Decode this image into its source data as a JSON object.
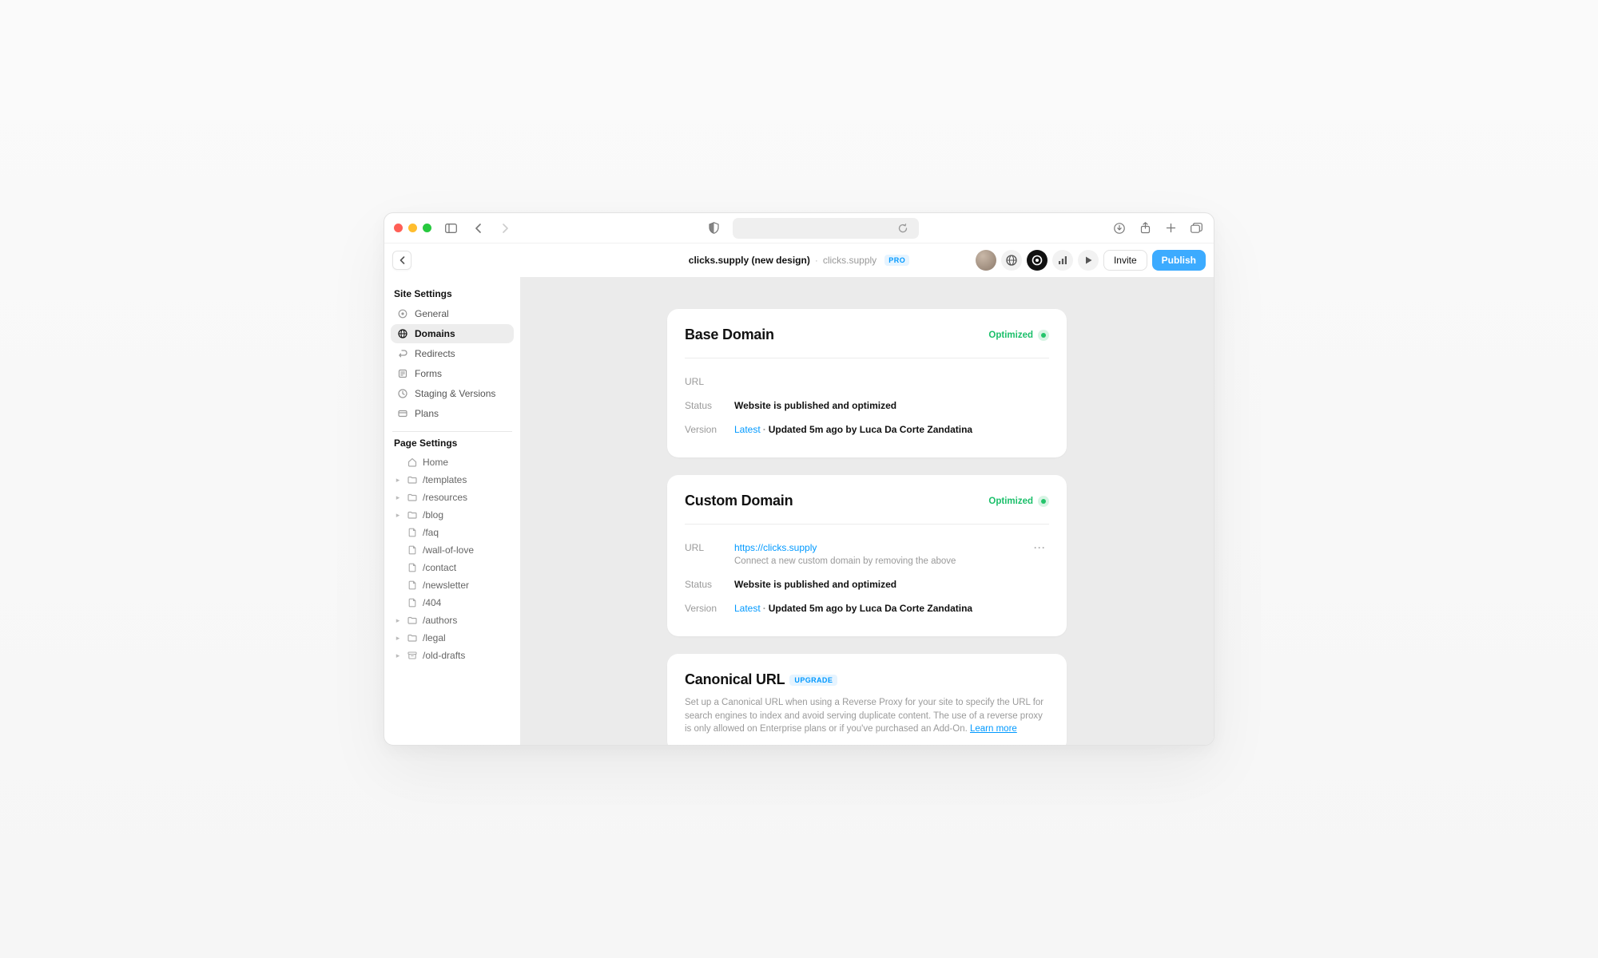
{
  "appbar": {
    "title": "clicks.supply (new design)",
    "subtitle": "clicks.supply",
    "pro_label": "PRO",
    "invite_label": "Invite",
    "publish_label": "Publish"
  },
  "sidebar": {
    "site_settings_header": "Site Settings",
    "site_items": [
      {
        "icon": "gear",
        "label": "General"
      },
      {
        "icon": "globe",
        "label": "Domains"
      },
      {
        "icon": "redirect",
        "label": "Redirects"
      },
      {
        "icon": "form",
        "label": "Forms"
      },
      {
        "icon": "clock",
        "label": "Staging & Versions"
      },
      {
        "icon": "card",
        "label": "Plans"
      }
    ],
    "active_site_index": 1,
    "page_settings_header": "Page Settings",
    "pages": [
      {
        "icon": "home",
        "label": "Home",
        "caret": false
      },
      {
        "icon": "folder",
        "label": "/templates",
        "caret": true
      },
      {
        "icon": "folder",
        "label": "/resources",
        "caret": true
      },
      {
        "icon": "folder",
        "label": "/blog",
        "caret": true
      },
      {
        "icon": "page",
        "label": "/faq",
        "caret": false,
        "indent": true
      },
      {
        "icon": "page",
        "label": "/wall-of-love",
        "caret": false,
        "indent": true
      },
      {
        "icon": "page",
        "label": "/contact",
        "caret": false,
        "indent": true
      },
      {
        "icon": "page",
        "label": "/newsletter",
        "caret": false,
        "indent": true
      },
      {
        "icon": "page",
        "label": "/404",
        "caret": false,
        "indent": true
      },
      {
        "icon": "folder",
        "label": "/authors",
        "caret": true
      },
      {
        "icon": "folder",
        "label": "/legal",
        "caret": true
      },
      {
        "icon": "archive",
        "label": "/old-drafts",
        "caret": true
      }
    ]
  },
  "cards": {
    "base": {
      "title": "Base Domain",
      "status_chip": "Optimized",
      "url_label": "URL",
      "url_value": "",
      "status_label": "Status",
      "status_value": "Website is published and optimized",
      "version_label": "Version",
      "version_latest": "Latest",
      "version_rest": "Updated 5m ago by Luca Da Corte Zandatina"
    },
    "custom": {
      "title": "Custom Domain",
      "status_chip": "Optimized",
      "url_label": "URL",
      "url_value": "https://clicks.supply",
      "url_hint": "Connect a new custom domain by removing the above",
      "status_label": "Status",
      "status_value": "Website is published and optimized",
      "version_label": "Version",
      "version_latest": "Latest",
      "version_rest": "Updated 5m ago by Luca Da Corte Zandatina"
    },
    "canonical": {
      "title": "Canonical URL",
      "upgrade_label": "UPGRADE",
      "description_pre": "Set up a Canonical URL when using a Reverse Proxy for your site to specify the URL for search engines to index and avoid serving duplicate content. The use of a reverse proxy is only allowed on Enterprise plans or if you've purchased an Add-On. ",
      "learn_more": "Learn more"
    }
  }
}
